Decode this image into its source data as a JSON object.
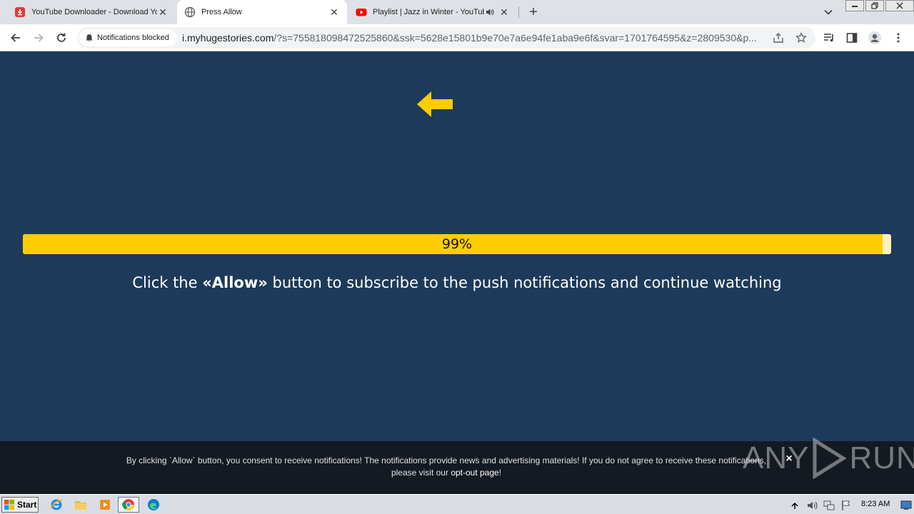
{
  "tabs": [
    {
      "title": "YouTube Downloader - Download YouTube",
      "favicon": "download-icon",
      "color": "#e53935"
    },
    {
      "title": "Press Allow",
      "favicon": "globe-icon",
      "active": true
    },
    {
      "title": "Playlist | Jazz in Winter - YouTube",
      "favicon": "youtube-icon",
      "color": "#ff0000",
      "audio": true
    }
  ],
  "toolbar": {
    "notification_chip": "Notifications blocked",
    "url_host": "i.myhugestories.com",
    "url_rest": "/?s=755818098472525860&ssk=5628e15801b9e70e7a6e94fe1aba9e6f&svar=1701764595&z=2809530&p..."
  },
  "page": {
    "progress": {
      "value": 99,
      "label": "99%"
    },
    "instruction_before": "Click the ",
    "instruction_bold": "«Allow»",
    "instruction_after": " button to subscribe to the push notifications and continue watching",
    "accent_color": "#ffcc00",
    "background_color": "#1e3a5a"
  },
  "consent": {
    "text_line1": "By clicking `Allow` button, you consent to receive notifications! The notifications provide news and advertising materials! If you do not agree to receive these notifications,",
    "text_line2_before": "please visit our ",
    "opt_out_link": "opt-out page",
    "text_line2_after": "!",
    "close_label": "×",
    "watermark": "ANY RUN"
  },
  "taskbar": {
    "start_label": "Start",
    "clock": "8:23 AM"
  }
}
